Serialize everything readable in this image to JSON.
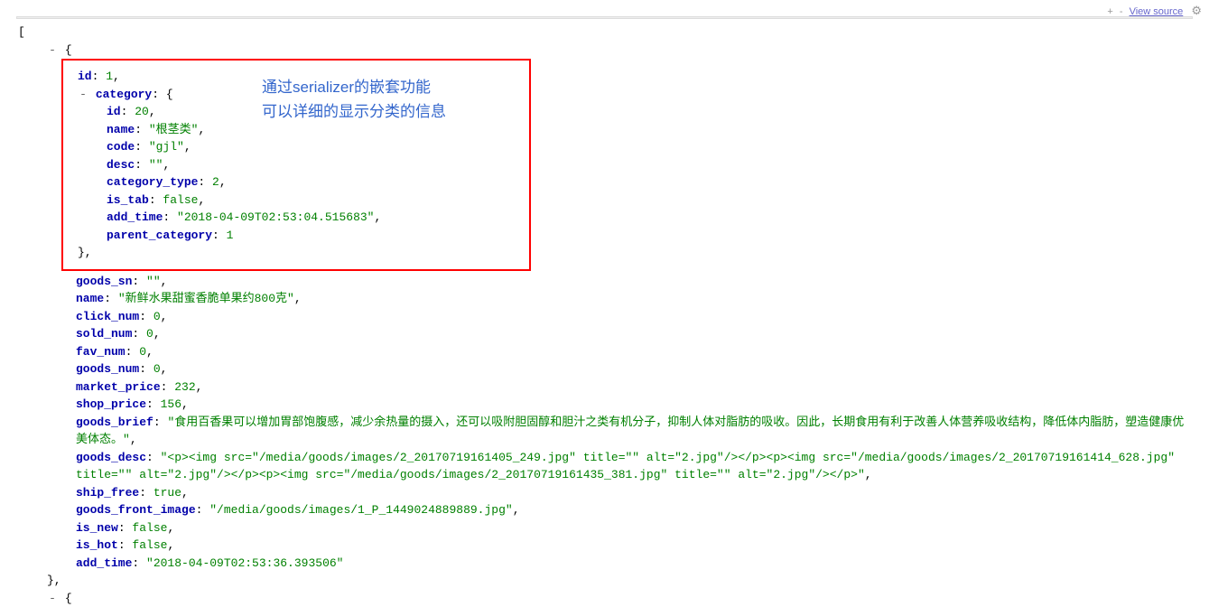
{
  "topbar": {
    "plus": "+",
    "minus": "-",
    "view_source": "View source",
    "gear": "⚙"
  },
  "annotation": {
    "line1": "通过serializer的嵌套功能",
    "line2": "可以详细的显示分类的信息"
  },
  "json": {
    "open_bracket": "[",
    "obj_open": "{",
    "id_key": "id",
    "id_val": "1",
    "category_key": "category",
    "cat_id_key": "id",
    "cat_id_val": "20",
    "cat_name_key": "name",
    "cat_name_val": "\"根茎类\"",
    "cat_code_key": "code",
    "cat_code_val": "\"gjl\"",
    "cat_desc_key": "desc",
    "cat_desc_val": "\"\"",
    "cat_type_key": "category_type",
    "cat_type_val": "2",
    "cat_tab_key": "is_tab",
    "cat_tab_val": "false",
    "cat_time_key": "add_time",
    "cat_time_val": "\"2018-04-09T02:53:04.515683\"",
    "cat_parent_key": "parent_category",
    "cat_parent_val": "1",
    "cat_close": "},",
    "sn_key": "goods_sn",
    "sn_val": "\"\"",
    "name_key": "name",
    "name_val": "\"新鲜水果甜蜜香脆单果约800克\"",
    "click_key": "click_num",
    "click_val": "0",
    "sold_key": "sold_num",
    "sold_val": "0",
    "fav_key": "fav_num",
    "fav_val": "0",
    "goods_num_key": "goods_num",
    "goods_num_val": "0",
    "market_key": "market_price",
    "market_val": "232",
    "shop_key": "shop_price",
    "shop_val": "156",
    "brief_key": "goods_brief",
    "brief_val": "\"食用百香果可以增加胃部饱腹感，减少余热量的摄入，还可以吸附胆固醇和胆汁之类有机分子，抑制人体对脂肪的吸收。因此，长期食用有利于改善人体营养吸收结构，降低体内脂肪，塑造健康优美体态。\"",
    "desc_key": "goods_desc",
    "desc_val": "\"<p><img src=\"/media/goods/images/2_20170719161405_249.jpg\" title=\"\" alt=\"2.jpg\"/></p><p><img src=\"/media/goods/images/2_20170719161414_628.jpg\" title=\"\" alt=\"2.jpg\"/></p><p><img src=\"/media/goods/images/2_20170719161435_381.jpg\" title=\"\" alt=\"2.jpg\"/></p>\"",
    "ship_key": "ship_free",
    "ship_val": "true",
    "front_key": "goods_front_image",
    "front_val": "\"/media/goods/images/1_P_1449024889889.jpg\"",
    "new_key": "is_new",
    "new_val": "false",
    "hot_key": "is_hot",
    "hot_val": "false",
    "time_key": "add_time",
    "time_val": "\"2018-04-09T02:53:36.393506\"",
    "obj_close": "},",
    "obj2_open": "{"
  }
}
